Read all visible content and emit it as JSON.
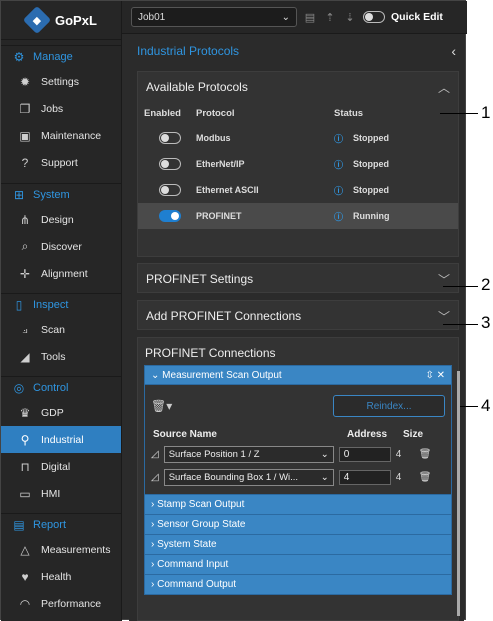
{
  "app": {
    "logo_text": "GoPxL"
  },
  "sidebar": {
    "sections": [
      {
        "label": "Manage",
        "icon": "gears-icon",
        "items": [
          {
            "label": "Settings",
            "icon": "gear-icon"
          },
          {
            "label": "Jobs",
            "icon": "files-icon"
          },
          {
            "label": "Maintenance",
            "icon": "toolbox-icon"
          },
          {
            "label": "Support",
            "icon": "help-icon"
          }
        ]
      },
      {
        "label": "System",
        "icon": "network-icon",
        "items": [
          {
            "label": "Design",
            "icon": "design-icon"
          },
          {
            "label": "Discover",
            "icon": "discover-icon"
          },
          {
            "label": "Alignment",
            "icon": "alignment-icon"
          }
        ]
      },
      {
        "label": "Inspect",
        "icon": "inspect-icon",
        "items": [
          {
            "label": "Scan",
            "icon": "scan-icon"
          },
          {
            "label": "Tools",
            "icon": "tools-icon"
          }
        ]
      },
      {
        "label": "Control",
        "icon": "control-icon",
        "items": [
          {
            "label": "GDP",
            "icon": "gdp-icon"
          },
          {
            "label": "Industrial",
            "icon": "industrial-icon",
            "active": true
          },
          {
            "label": "Digital",
            "icon": "digital-icon"
          },
          {
            "label": "HMI",
            "icon": "hmi-icon"
          }
        ]
      },
      {
        "label": "Report",
        "icon": "report-icon",
        "items": [
          {
            "label": "Measurements",
            "icon": "measurements-icon"
          },
          {
            "label": "Health",
            "icon": "health-icon"
          },
          {
            "label": "Performance",
            "icon": "performance-icon"
          }
        ]
      }
    ]
  },
  "toolbar": {
    "job": "Job01",
    "quick_edit": "Quick Edit"
  },
  "panel": {
    "title": "Industrial Protocols"
  },
  "available": {
    "title": "Available Protocols",
    "headers": {
      "enabled": "Enabled",
      "protocol": "Protocol",
      "status": "Status"
    },
    "rows": [
      {
        "protocol": "Modbus",
        "status": "Stopped",
        "enabled": false
      },
      {
        "protocol": "EtherNet/IP",
        "status": "Stopped",
        "enabled": false
      },
      {
        "protocol": "Ethernet ASCII",
        "status": "Stopped",
        "enabled": false
      },
      {
        "protocol": "PROFINET",
        "status": "Running",
        "enabled": true
      }
    ]
  },
  "profinet_settings": {
    "title": "PROFINET Settings"
  },
  "add_connections": {
    "title": "Add PROFINET Connections"
  },
  "connections": {
    "title": "PROFINET Connections",
    "expanded": {
      "title": "Measurement Scan Output",
      "reindex": "Reindex...",
      "headers": {
        "source": "Source Name",
        "address": "Address",
        "size": "Size"
      },
      "rows": [
        {
          "source": "Surface Position 1 / Z",
          "address": "0",
          "size": "4"
        },
        {
          "source": "Surface Bounding Box 1 / Wi...",
          "address": "4",
          "size": "4"
        }
      ]
    },
    "collapsed": [
      "Stamp Scan Output",
      "Sensor Group State",
      "System State",
      "Command Input",
      "Command Output"
    ]
  },
  "callouts": [
    "1",
    "2",
    "3",
    "4"
  ]
}
